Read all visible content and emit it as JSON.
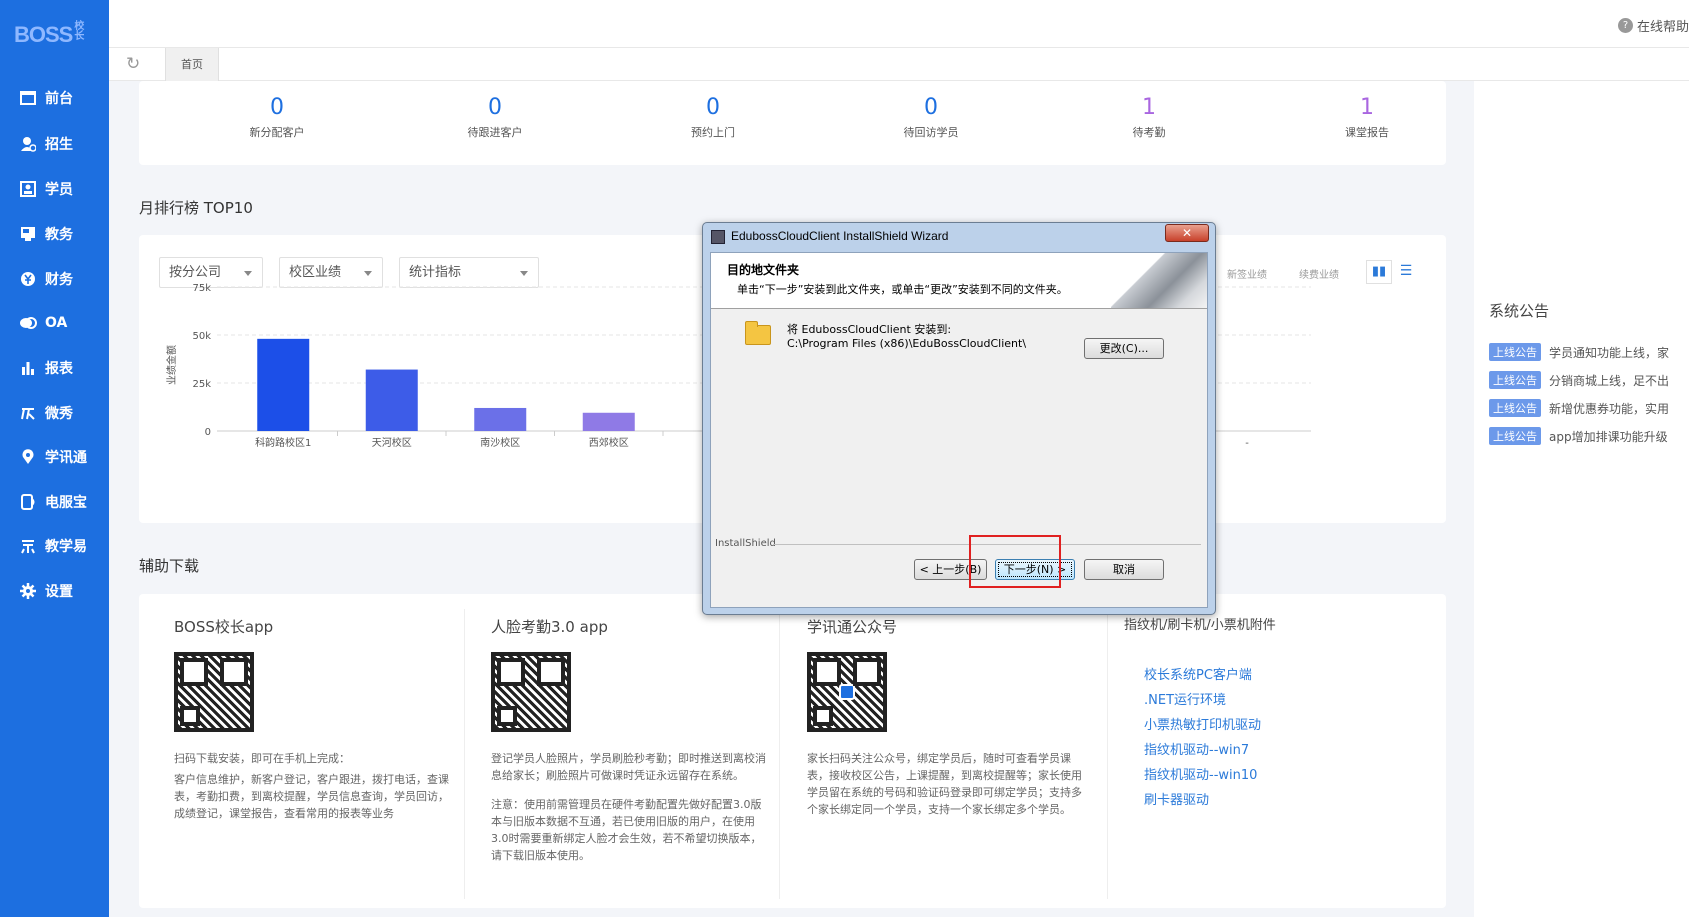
{
  "app": {
    "logo": "BOSS",
    "logo_sub": "校长"
  },
  "sidebar": {
    "items": [
      {
        "label": "前台",
        "icon": "monitor-icon"
      },
      {
        "label": "招生",
        "icon": "user-plus-icon"
      },
      {
        "label": "学员",
        "icon": "id-card-icon"
      },
      {
        "label": "教务",
        "icon": "board-icon"
      },
      {
        "label": "财务",
        "icon": "yen-icon"
      },
      {
        "label": "OA",
        "icon": "chat-icon"
      },
      {
        "label": "报表",
        "icon": "bar-chart-icon"
      },
      {
        "label": "微秀",
        "icon": "show-icon"
      },
      {
        "label": "学讯通",
        "icon": "location-icon"
      },
      {
        "label": "电服宝",
        "icon": "service-icon"
      },
      {
        "label": "教学易",
        "icon": "teach-icon"
      },
      {
        "label": "设置",
        "icon": "gear-icon"
      }
    ]
  },
  "header": {
    "help": "在线帮助"
  },
  "tabs": {
    "home": "首页"
  },
  "stats": [
    {
      "value": "0",
      "label": "新分配客户"
    },
    {
      "value": "0",
      "label": "待跟进客户"
    },
    {
      "value": "0",
      "label": "预约上门"
    },
    {
      "value": "0",
      "label": "待回访学员"
    },
    {
      "value": "1",
      "label": "待考勤"
    },
    {
      "value": "1",
      "label": "课堂报告"
    }
  ],
  "ranking": {
    "title": "月排行榜 TOP10",
    "filters": [
      "按分公司",
      "校区业绩",
      "统计指标"
    ],
    "legend": [
      "新签业绩",
      "续费业绩"
    ],
    "ylabel": "业绩金额",
    "yticks": [
      "75k",
      "50k",
      "25k",
      "0"
    ],
    "bar_colors": [
      "#1c4fe8",
      "#3d5ce8",
      "#6b70e8",
      "#8f7ae6"
    ]
  },
  "chart_data": {
    "type": "bar",
    "categories": [
      "科韵路校区1",
      "天河校区",
      "南沙校区",
      "西郊校区",
      "-",
      "-"
    ],
    "values": [
      48000,
      32000,
      12000,
      9500,
      0,
      0
    ],
    "ylabel": "业绩金额",
    "ylim": [
      0,
      75000
    ],
    "ticks": [
      "0",
      "25k",
      "50k",
      "75k"
    ]
  },
  "downloads": {
    "title": "辅助下载",
    "cols": [
      {
        "title": "BOSS校长app",
        "text": [
          "扫码下载安装，即可在手机上完成：",
          "客户信息维护，新客户登记，客户跟进，拨打电话，查课表，考勤扣费，到离校提醒，学员信息查询，学员回访，成绩登记，课堂报告，查看常用的报表等业务"
        ]
      },
      {
        "title": "人脸考勤3.0 app",
        "text": [
          "登记学员人脸照片，学员刷脸秒考勤；即时推送到离校消息给家长；刷脸照片可做课时凭证永远留存在系统。",
          "注意：使用前需管理员在硬件考勤配置先做好配置3.0版本与旧版本数据不互通，若已使用旧版的用户，在使用3.0时需要重新绑定人脸才会生效，若不希望切换版本，请下载旧版本使用。"
        ]
      },
      {
        "title": "学讯通公众号",
        "text": [
          "家长扫码关注公众号，绑定学员后，随时可查看学员课表，接收校区公告，上课提醒，到离校提醒等；家长使用学员留在系统的号码和验证码登录即可绑定学员；支持多个家长绑定同一个学员，支持一个家长绑定多个学员。"
        ]
      }
    ],
    "misc_title": "指纹机/刷卡机/小票机附件",
    "links": [
      "校长系统PC客户端",
      ".NET运行环境",
      "小票热敏打印机驱动",
      "指纹机驱动--win7",
      "指纹机驱动--win10",
      "刷卡器驱动"
    ]
  },
  "notice": {
    "title": "系统公告",
    "items": [
      {
        "tag": "上线公告",
        "text": "学员通知功能上线，家"
      },
      {
        "tag": "上线公告",
        "text": "分销商城上线，足不出"
      },
      {
        "tag": "上线公告",
        "text": "新增优惠券功能，实用"
      },
      {
        "tag": "上线公告",
        "text": "app增加排课功能升级"
      }
    ]
  },
  "dialog": {
    "title": "EdubossCloudClient InstallShield Wizard",
    "close": "✕",
    "heading": "目的地文件夹",
    "subheading": "单击“下一步”安装到此文件夹，或单击“更改”安装到不同的文件夹。",
    "install_label": "将 EdubossCloudClient 安装到:",
    "install_path": "C:\\Program Files (x86)\\EduBossCloudClient\\",
    "change_button": "更改(C)...",
    "brand": "InstallShield",
    "back_button": "< 上一步(B)",
    "next_button": "下一步(N) >",
    "cancel_button": "取消"
  }
}
